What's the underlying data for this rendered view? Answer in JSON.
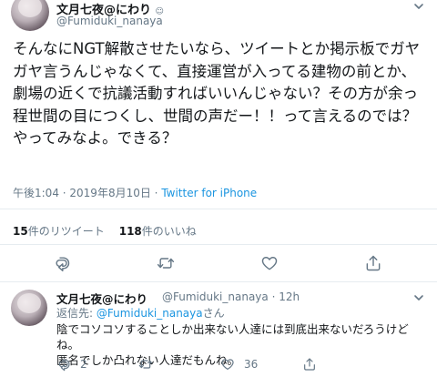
{
  "main_tweet": {
    "display_name": "文月七夜@にわり",
    "verified_glyph": "☺",
    "handle": "@Fumiduki_nanaya",
    "text": "そんなにNGT解散させたいなら、ツイートとか掲示板でガヤガヤ言うんじゃなくて、直接運営が入ってる建物の前とか、劇場の近くで抗議活動すればいいんじゃない？その方が余っ程世間の目につくし、世間の声だー！！って言えるのでは？\nやってみなよ。できる？",
    "time": "午後1:04",
    "separator": " · ",
    "date": "2019年8月10日",
    "source": "Twitter for iPhone",
    "retweets_count": "15",
    "retweets_label": "件のリツイート",
    "likes_count": "118",
    "likes_label": "件のいいね"
  },
  "reply": {
    "display_name": "文月七夜@にわり",
    "handle": "@Fumiduki_nanaya",
    "time": "12h",
    "reply_to_label": "返信先: ",
    "reply_to_handle": "@Fumiduki_nanaya",
    "reply_to_suffix": "さん",
    "text": "陰でコソコソすることしか出来ない人達には到底出来ないだろうけどね。\n匿名でしか凸れない人達だもんね。",
    "reply_count": "2",
    "retweet_count": "",
    "like_count": "36"
  },
  "icons": {
    "reply": "reply-icon",
    "retweet": "retweet-icon",
    "like": "heart-icon",
    "share": "share-icon",
    "menu": "chevron-down-icon"
  },
  "colors": {
    "link": "#1b95e0",
    "secondary_text": "#657786",
    "divider": "#e6ecf0"
  }
}
